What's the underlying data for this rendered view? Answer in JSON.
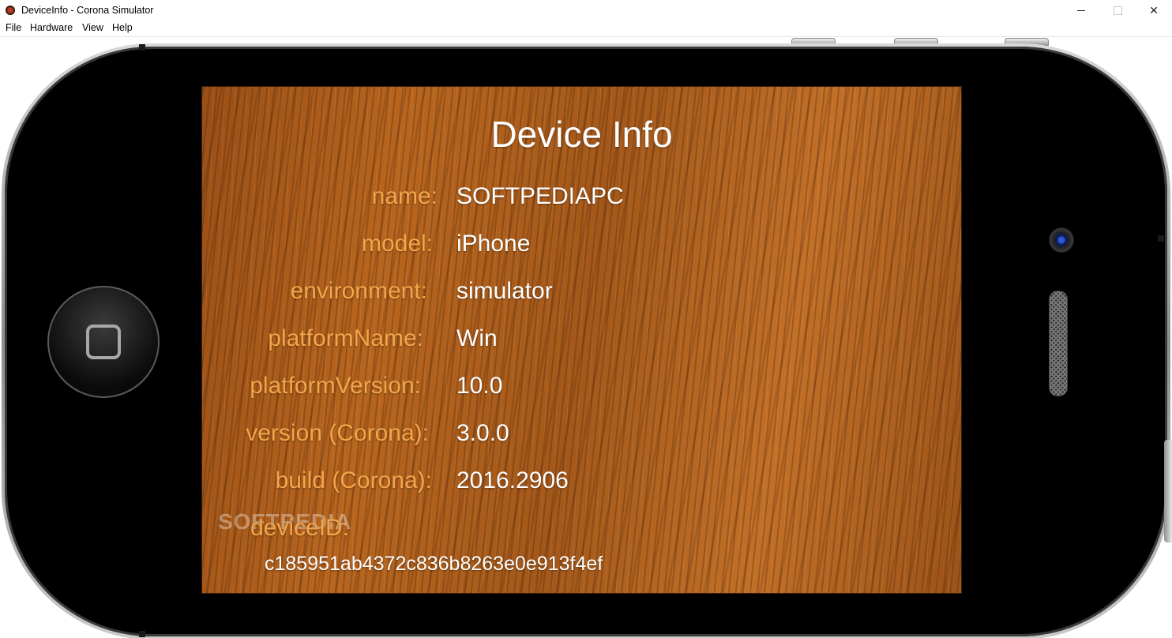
{
  "window": {
    "title": "DeviceInfo - Corona Simulator",
    "minimize_label": "—",
    "maximize_label": "□",
    "close_label": "✕"
  },
  "menu": {
    "items": [
      "File",
      "Hardware",
      "View",
      "Help"
    ]
  },
  "screen": {
    "title": "Device Info",
    "rows": [
      {
        "label": "name:",
        "value": "SOFTPEDIAPC"
      },
      {
        "label": "model:",
        "value": "iPhone"
      },
      {
        "label": "environment:",
        "value": "simulator"
      },
      {
        "label": "platformName:",
        "value": "Win"
      },
      {
        "label": "platformVersion:",
        "value": "10.0"
      },
      {
        "label": "version (Corona):",
        "value": "3.0.0"
      },
      {
        "label": "build (Corona):",
        "value": "2016.2906"
      }
    ],
    "device_id_label": "deviceID:",
    "device_id_value": "c185951ab4372c836b8263e0e913f4ef",
    "watermark": "SOFTPEDIA",
    "label_color": "#f4a64a",
    "value_color": "#ffffff"
  }
}
